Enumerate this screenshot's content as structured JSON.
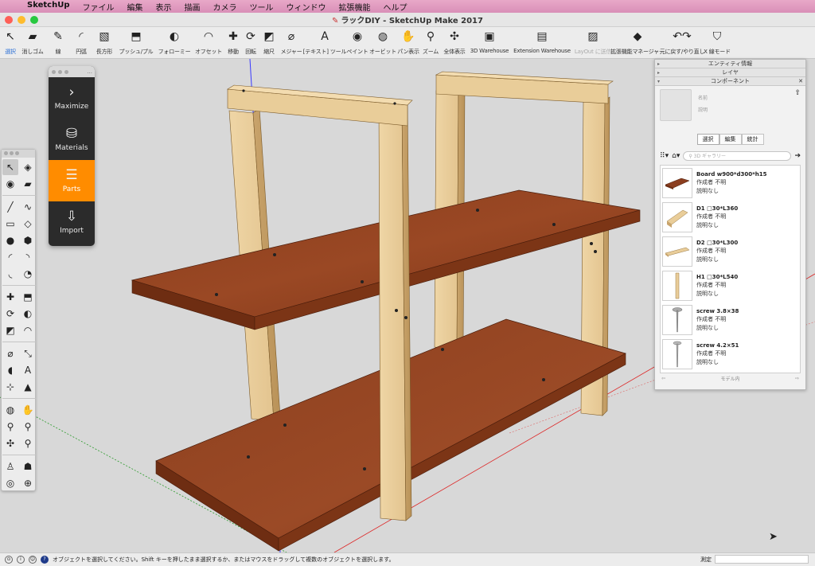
{
  "menubar": {
    "apple": "",
    "items": [
      "SketchUp",
      "ファイル",
      "編集",
      "表示",
      "描画",
      "カメラ",
      "ツール",
      "ウィンドウ",
      "拡張機能",
      "ヘルプ"
    ]
  },
  "window": {
    "title": "ラックDIY - SketchUp Make 2017"
  },
  "toolbar": [
    {
      "label": "選択",
      "icon": "select-arrow-icon",
      "glyph": "↖",
      "selected": true
    },
    {
      "label": "消しゴム",
      "icon": "eraser-icon",
      "glyph": "▰"
    },
    {
      "label": "線",
      "icon": "pencil-icon",
      "glyph": "✎"
    },
    {
      "label": "円弧",
      "icon": "arc-icon",
      "glyph": "◜"
    },
    {
      "label": "長方形",
      "icon": "rectangle-icon",
      "glyph": "▧"
    },
    {
      "label": "プッシュ/プル",
      "icon": "push-pull-icon",
      "glyph": "⬒"
    },
    {
      "label": "フォローミー",
      "icon": "follow-me-icon",
      "glyph": "◐"
    },
    {
      "label": "オフセット",
      "icon": "offset-icon",
      "glyph": "◠"
    },
    {
      "label": "移動",
      "icon": "move-icon",
      "glyph": "✚"
    },
    {
      "label": "回転",
      "icon": "rotate-icon",
      "glyph": "⟳"
    },
    {
      "label": "縮尺",
      "icon": "scale-icon",
      "glyph": "◩"
    },
    {
      "label": "メジャー",
      "icon": "tape-measure-icon",
      "glyph": "⌀"
    },
    {
      "label": "[テキスト] ツール",
      "icon": "text-tool-icon",
      "glyph": "A"
    },
    {
      "label": "ペイント",
      "icon": "paint-bucket-icon",
      "glyph": "◉"
    },
    {
      "label": "オービット",
      "icon": "orbit-icon",
      "glyph": "◍"
    },
    {
      "label": "パン表示",
      "icon": "pan-hand-icon",
      "glyph": "✋"
    },
    {
      "label": "ズーム",
      "icon": "zoom-icon",
      "glyph": "⚲"
    },
    {
      "label": "全体表示",
      "icon": "zoom-extents-icon",
      "glyph": "✣"
    },
    {
      "label": "3D Warehouse",
      "icon": "warehouse-icon",
      "glyph": "▣"
    },
    {
      "label": "Extension Warehouse",
      "icon": "extension-warehouse-icon",
      "glyph": "▤"
    },
    {
      "label": "LayOut に送信",
      "icon": "layout-icon",
      "glyph": "▨",
      "dim": true
    },
    {
      "label": "拡張機能マネージャー",
      "icon": "extension-manager-icon",
      "glyph": "◆"
    },
    {
      "label": "元に戻す/やり直し",
      "icon": "undo-redo-icon",
      "glyph": "↶↷"
    },
    {
      "label": "X 線モード",
      "icon": "xray-icon",
      "glyph": "⛉"
    }
  ],
  "plugin_panel": {
    "buttons": [
      {
        "label": "Maximize",
        "icon": "chevron-right-icon",
        "glyph": "›"
      },
      {
        "label": "Materials",
        "icon": "paint-bucket-icon",
        "glyph": "⛁"
      },
      {
        "label": "Parts",
        "icon": "parts-list-icon",
        "glyph": "☰",
        "active": true
      },
      {
        "label": "Import",
        "icon": "import-icon",
        "glyph": "⇩"
      }
    ]
  },
  "left_tools": [
    {
      "icon": "select-arrow-icon",
      "glyph": "↖",
      "selected": true
    },
    {
      "icon": "make-component-icon",
      "glyph": "◈"
    },
    {
      "icon": "paint-bucket-icon",
      "glyph": "◉"
    },
    {
      "icon": "eraser-icon",
      "glyph": "▰"
    },
    {
      "sep": true
    },
    {
      "icon": "pencil-icon",
      "glyph": "╱"
    },
    {
      "icon": "freehand-icon",
      "glyph": "∿"
    },
    {
      "icon": "rectangle-icon",
      "glyph": "▭"
    },
    {
      "icon": "rotated-rectangle-icon",
      "glyph": "◇"
    },
    {
      "icon": "circle-icon",
      "glyph": "●"
    },
    {
      "icon": "polygon-icon",
      "glyph": "⬢"
    },
    {
      "icon": "arc-icon",
      "glyph": "◜"
    },
    {
      "icon": "two-point-arc-icon",
      "glyph": "◝"
    },
    {
      "icon": "three-point-arc-icon",
      "glyph": "◟"
    },
    {
      "icon": "pie-icon",
      "glyph": "◔"
    },
    {
      "sep": true
    },
    {
      "icon": "move-icon",
      "glyph": "✚"
    },
    {
      "icon": "push-pull-icon",
      "glyph": "⬒"
    },
    {
      "icon": "rotate-icon",
      "glyph": "⟳"
    },
    {
      "icon": "follow-me-icon",
      "glyph": "◐"
    },
    {
      "icon": "scale-icon",
      "glyph": "◩"
    },
    {
      "icon": "offset-icon",
      "glyph": "◠"
    },
    {
      "sep": true
    },
    {
      "icon": "tape-measure-icon",
      "glyph": "⌀"
    },
    {
      "icon": "dimension-icon",
      "glyph": "⤡"
    },
    {
      "icon": "protractor-icon",
      "glyph": "◖"
    },
    {
      "icon": "text-icon",
      "glyph": "A"
    },
    {
      "icon": "axes-icon",
      "glyph": "⊹"
    },
    {
      "icon": "3d-text-icon",
      "glyph": "▲"
    },
    {
      "sep": true
    },
    {
      "icon": "orbit-icon",
      "glyph": "◍"
    },
    {
      "icon": "pan-hand-icon",
      "glyph": "✋"
    },
    {
      "icon": "zoom-icon",
      "glyph": "⚲"
    },
    {
      "icon": "zoom-window-icon",
      "glyph": "⚲"
    },
    {
      "icon": "zoom-extents-icon",
      "glyph": "✣"
    },
    {
      "icon": "previous-view-icon",
      "glyph": "⚲"
    },
    {
      "sep": true
    },
    {
      "icon": "position-camera-icon",
      "glyph": "♙"
    },
    {
      "icon": "walk-icon",
      "glyph": "☗"
    },
    {
      "icon": "look-around-icon",
      "glyph": "◎"
    },
    {
      "icon": "section-plane-icon",
      "glyph": "⊕"
    }
  ],
  "tray": {
    "headers": [
      "エンティティ情報",
      "レイヤ",
      "コンポーネント"
    ],
    "meta_name": "名前",
    "meta_desc": "説明",
    "tabs": [
      "選択",
      "編集",
      "統計"
    ],
    "search_placeholder": "3D ギャラリー",
    "components": [
      {
        "name": "Board w900*d300*h15",
        "author": "作成者 不明",
        "desc": "説明なし",
        "kind": "board"
      },
      {
        "name": "D1 □30*L360",
        "author": "作成者 不明",
        "desc": "説明なし",
        "kind": "beam"
      },
      {
        "name": "D2 □30*L300",
        "author": "作成者 不明",
        "desc": "説明なし",
        "kind": "beam2"
      },
      {
        "name": "H1 □30*L540",
        "author": "作成者 不明",
        "desc": "説明なし",
        "kind": "post"
      },
      {
        "name": "screw 3.8×38",
        "author": "作成者 不明",
        "desc": "説明なし",
        "kind": "screw"
      },
      {
        "name": "screw 4.2×51",
        "author": "作成者 不明",
        "desc": "説明なし",
        "kind": "screw2"
      }
    ],
    "footer": "モデル内"
  },
  "status": {
    "message": "オブジェクトを選択してください。Shift キーを押したまま選択するか、またはマウスをドラッグして複数のオブジェクトを選択します。",
    "measure_label": "測定"
  },
  "colors": {
    "wood_light": "#e6c995",
    "wood_dark": "#b8955f",
    "board": "#8b3e1f",
    "active_orange": "#ff8c00",
    "viewport_bg": "#d8d8d8"
  }
}
